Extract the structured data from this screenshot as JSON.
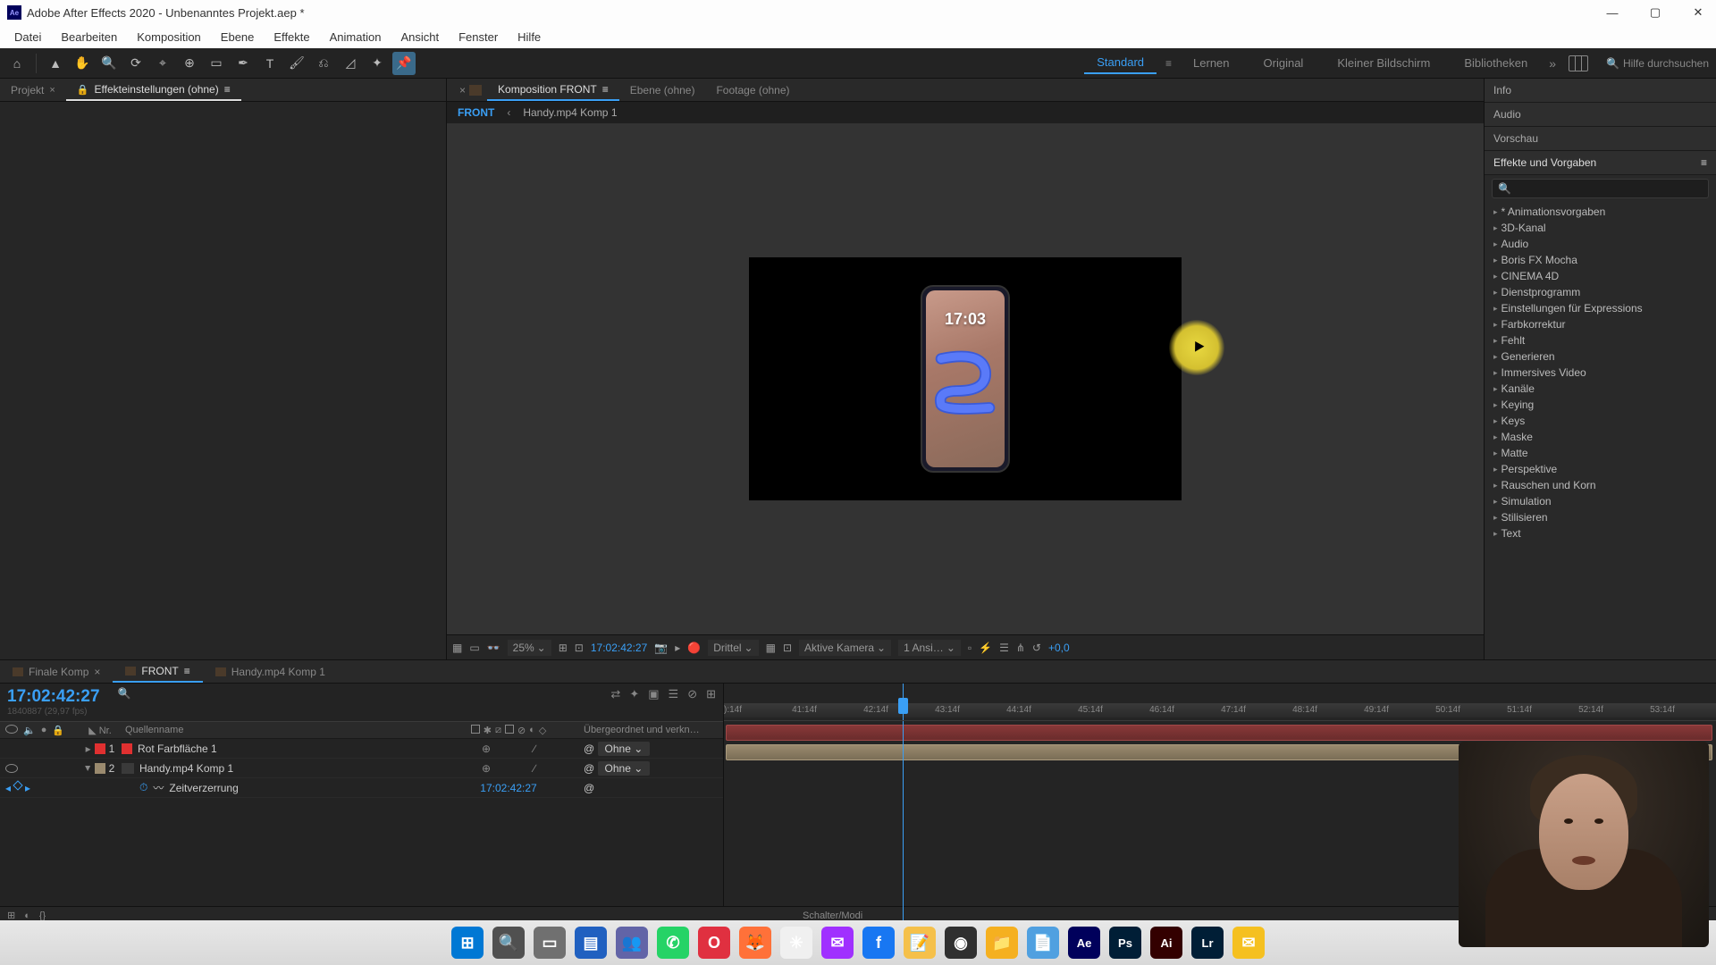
{
  "titlebar": {
    "title": "Adobe After Effects 2020 - Unbenanntes Projekt.aep *"
  },
  "menu": {
    "items": [
      "Datei",
      "Bearbeiten",
      "Komposition",
      "Ebene",
      "Effekte",
      "Animation",
      "Ansicht",
      "Fenster",
      "Hilfe"
    ]
  },
  "workspaces": {
    "items": [
      "Standard",
      "Lernen",
      "Original",
      "Kleiner Bildschirm",
      "Bibliotheken"
    ],
    "active": "Standard",
    "search_placeholder": "Hilfe durchsuchen"
  },
  "left_panels": {
    "project_tab": "Projekt",
    "effect_controls_tab": "Effekteinstellungen (ohne)"
  },
  "comp_panel": {
    "tabs": {
      "composition": "Komposition FRONT",
      "layer": "Ebene (ohne)",
      "footage": "Footage (ohne)"
    },
    "breadcrumb": {
      "active": "FRONT",
      "child": "Handy.mp4 Komp 1"
    },
    "phone_time": "17:03"
  },
  "viewer_footer": {
    "zoom": "25%",
    "timecode": "17:02:42:27",
    "resolution": "Drittel",
    "camera": "Aktive Kamera",
    "views": "1 Ansi…",
    "exposure": "+0,0"
  },
  "right_panels": {
    "info": "Info",
    "audio": "Audio",
    "preview": "Vorschau",
    "effects_title": "Effekte und Vorgaben",
    "effects": [
      "* Animationsvorgaben",
      "3D-Kanal",
      "Audio",
      "Boris FX Mocha",
      "CINEMA 4D",
      "Dienstprogramm",
      "Einstellungen für Expressions",
      "Farbkorrektur",
      "Fehlt",
      "Generieren",
      "Immersives Video",
      "Kanäle",
      "Keying",
      "Keys",
      "Maske",
      "Matte",
      "Perspektive",
      "Rauschen und Korn",
      "Simulation",
      "Stilisieren",
      "Text"
    ]
  },
  "timeline": {
    "tabs": [
      "Finale Komp",
      "FRONT",
      "Handy.mp4 Komp 1"
    ],
    "active_tab": "FRONT",
    "current_time": "17:02:42:27",
    "fps_note": "1840887 (29,97 fps)",
    "columns": {
      "nr": "Nr.",
      "source": "Quellenname",
      "parent": "Übergeordnet und verkn…"
    },
    "layers": [
      {
        "nr": "1",
        "name": "Rot Farbfläche 1",
        "color": "red",
        "parent": "Ohne"
      },
      {
        "nr": "2",
        "name": "Handy.mp4 Komp 1",
        "color": "tan",
        "parent": "Ohne"
      }
    ],
    "time_remap_label": "Zeitverzerrung",
    "time_remap_value": "17:02:42:27",
    "ruler_ticks": [
      "):14f",
      "41:14f",
      "42:14f",
      "43:14f",
      "44:14f",
      "45:14f",
      "46:14f",
      "47:14f",
      "48:14f",
      "49:14f",
      "50:14f",
      "51:14f",
      "52:14f",
      "53:14f"
    ],
    "footer_label": "Schalter/Modi"
  },
  "taskbar": {
    "apps": [
      {
        "name": "windows-start",
        "bg": "#0078d4",
        "glyph": "⊞"
      },
      {
        "name": "search",
        "bg": "#505050",
        "glyph": "🔍"
      },
      {
        "name": "task-view",
        "bg": "#707070",
        "glyph": "▭"
      },
      {
        "name": "explorer",
        "bg": "#2060c0",
        "glyph": "▤"
      },
      {
        "name": "teams",
        "bg": "#6264a7",
        "glyph": "👥"
      },
      {
        "name": "whatsapp",
        "bg": "#25d366",
        "glyph": "✆"
      },
      {
        "name": "opera",
        "bg": "#e03040",
        "glyph": "O"
      },
      {
        "name": "firefox",
        "bg": "#ff7139",
        "glyph": "🦊"
      },
      {
        "name": "app-white",
        "bg": "#f0f0f0",
        "glyph": "✳"
      },
      {
        "name": "messenger",
        "bg": "#a030ff",
        "glyph": "✉"
      },
      {
        "name": "facebook",
        "bg": "#1877f2",
        "glyph": "f"
      },
      {
        "name": "notes",
        "bg": "#f5c04a",
        "glyph": "📝"
      },
      {
        "name": "obs",
        "bg": "#303030",
        "glyph": "◉"
      },
      {
        "name": "files",
        "bg": "#f5b020",
        "glyph": "📁"
      },
      {
        "name": "notepad",
        "bg": "#50a0e0",
        "glyph": "📄"
      },
      {
        "name": "after-effects",
        "bg": "#00005b",
        "glyph": "Ae"
      },
      {
        "name": "photoshop",
        "bg": "#001e36",
        "glyph": "Ps"
      },
      {
        "name": "illustrator",
        "bg": "#330000",
        "glyph": "Ai"
      },
      {
        "name": "lightroom",
        "bg": "#001e36",
        "glyph": "Lr"
      },
      {
        "name": "mail",
        "bg": "#f5c020",
        "glyph": "✉"
      }
    ]
  }
}
